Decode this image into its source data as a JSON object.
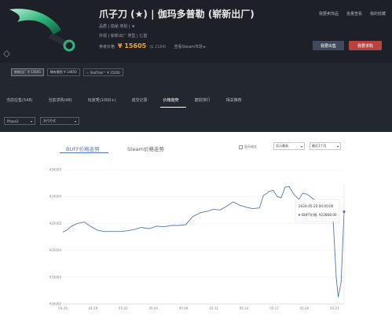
{
  "item": {
    "title": "爪子刀 (★) | 伽玛多普勒 (崭新出厂)",
    "meta1": "品质 | 隐秘      类别 | ★",
    "meta2": "外观 | 崭新出厂      类型 | 匕首",
    "price_label": "参考价格",
    "price": "¥ 15605",
    "price_alt": "($ 2184)",
    "steam_link": "查看Steam市场 ▸"
  },
  "top_links": [
    "我要卖饰品",
    "批量查看",
    "我的收藏"
  ],
  "buttons": {
    "sell": "我要出售",
    "buy": "我要求购"
  },
  "variants": [
    {
      "label": "崭新出厂 ¥ 15605",
      "active": true
    },
    {
      "label": "略有磨损 ¥ 14850",
      "active": false
    },
    {
      "label": "☆ StatTrak™ ¥ 15200",
      "active": false
    }
  ],
  "tabs": [
    {
      "label": "当前在售(548)",
      "active": false
    },
    {
      "label": "当前求购(48)",
      "active": false
    },
    {
      "label": "玩家秀(1000+)",
      "active": false
    },
    {
      "label": "成交记录",
      "active": false
    },
    {
      "label": "价格趋势",
      "active": true
    },
    {
      "label": "磨损排行",
      "active": false
    },
    {
      "label": "相关推荐",
      "active": false
    }
  ],
  "filters": {
    "phase": "Phase2",
    "pay": "支付方式"
  },
  "chart_tabs": {
    "buff": "BUFF价格走势",
    "steam": "Steam价格走势"
  },
  "options": {
    "check_label": "显示成交",
    "drop1": "显示最高",
    "drop2": "最近1个月"
  },
  "icons": {
    "check": "checkbox-icon",
    "caret": "caret-down-icon",
    "cube": "cube-icon"
  },
  "colors": {
    "line": "#4f78b5",
    "price": "#f5a623",
    "buy": "#b8423f"
  },
  "chart_data": {
    "type": "line",
    "y_ticks": [
      "¥26000",
      "¥24000",
      "¥22000",
      "¥20000",
      "¥18000",
      "¥16000"
    ],
    "x_ticks": [
      "04-26",
      "04-29",
      "05-02",
      "05-05",
      "05-08",
      "05-11",
      "05-14",
      "05-17",
      "05-20",
      "05-23"
    ],
    "ylim": [
      16000,
      26000
    ],
    "series": [
      {
        "x": [
          0,
          0.4,
          0.9,
          1.5,
          2.2,
          2.9,
          3.5,
          4.2,
          5.0,
          5.8,
          6.5,
          7.3,
          8.0,
          8.8,
          9.5,
          10.3,
          11.0,
          11.8,
          12.5,
          13.2,
          14.0,
          14.7,
          15.3,
          16.0,
          16.6,
          17.3,
          18.0,
          18.7,
          19.3,
          20.0,
          20.4,
          20.7,
          21.0,
          21.4,
          21.8,
          22.2,
          22.6,
          23.0,
          23.5,
          24.0,
          24.4,
          24.9,
          25.3,
          25.8,
          26.2,
          26.6,
          27.0,
          27.5,
          27.8,
          28.0,
          28.3,
          28.6
        ],
        "y": [
          21350,
          21500,
          21800,
          22000,
          22100,
          21750,
          21500,
          21400,
          21400,
          21400,
          21450,
          21550,
          21700,
          21600,
          21800,
          21750,
          21850,
          21850,
          21900,
          22500,
          22800,
          22900,
          23050,
          23000,
          23250,
          23600,
          23350,
          23200,
          23100,
          23150,
          24100,
          24200,
          24400,
          24450,
          24000,
          23900,
          24700,
          24750,
          24150,
          23800,
          24250,
          24150,
          23900,
          23700,
          23500,
          23400,
          23300,
          22100,
          18000,
          16500,
          17600,
          22870
        ]
      }
    ],
    "tooltip": {
      "date": "2024-05-23 00:00:00",
      "text": "BUFF价格: ¥22868.00"
    },
    "title": "",
    "xlabel": "",
    "ylabel": ""
  }
}
